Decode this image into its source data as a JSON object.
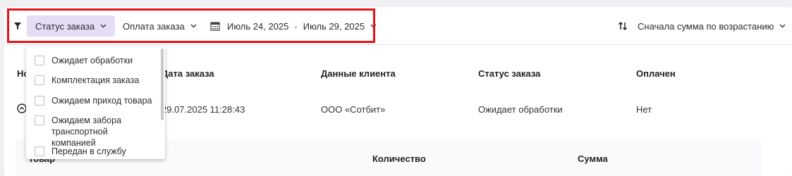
{
  "toolbar": {
    "filter_icon": "filter-icon",
    "status_filter_label": "Статус заказа",
    "payment_filter_label": "Оплата заказа",
    "date_from": "Июль 24, 2025",
    "date_separator": "-",
    "date_to": "Июль 29, 2025",
    "sort_label": "Сначала сумма по возрастанию",
    "accent_color": "#e6dcf4"
  },
  "status_dropdown": {
    "options": [
      "Ожидает обработки",
      "Комплектация заказа",
      "Ожидаем приход товара",
      "Ожидаем забора транспортной компанией",
      "Передан в службу"
    ]
  },
  "table": {
    "headers": [
      "Но",
      "Дата заказа",
      "Данные клиента",
      "Статус заказа",
      "Оплачен"
    ],
    "rows": [
      {
        "date": "29.07.2025 11:28:43",
        "client": "ООО «Сотбит»",
        "status": "Ожидает обработки",
        "paid": "Нет"
      }
    ]
  },
  "details": {
    "headers": [
      "Товар",
      "Количество",
      "Сумма"
    ]
  },
  "highlight_color": "#e8101b"
}
